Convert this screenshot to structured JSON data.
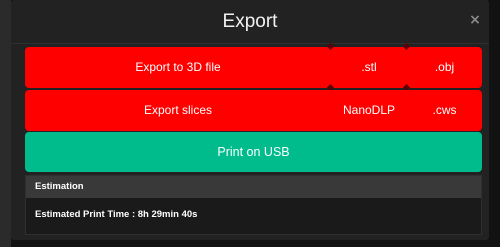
{
  "modal": {
    "title": "Export",
    "close_symbol": "×"
  },
  "buttons": {
    "export_3d": "Export to 3D file",
    "stl": ".stl",
    "obj": ".obj",
    "export_slices": "Export slices",
    "nanodlp": "NanoDLP",
    "cws": ".cws",
    "print_usb": "Print on USB"
  },
  "estimation": {
    "title": "Estimation",
    "print_time_label": "Estimated Print Time : 8h 29min 40s"
  },
  "colors": {
    "export_red": "#ff0000",
    "usb_green": "#00bc8c",
    "modal_bg": "#222222"
  },
  "icons": {
    "close": "close-icon"
  }
}
